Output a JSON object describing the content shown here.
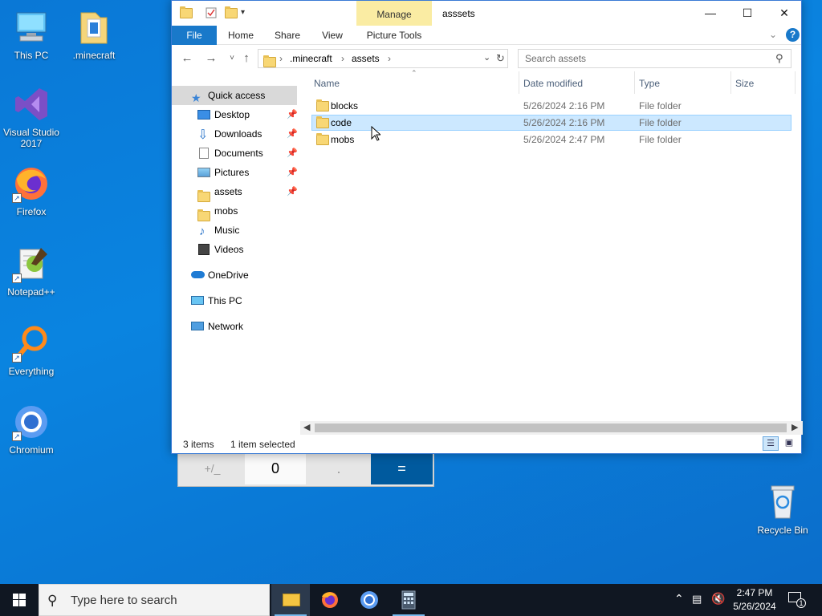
{
  "desktop": {
    "icons": [
      {
        "label": "This PC"
      },
      {
        "label": ".minecraft"
      },
      {
        "label": "Visual Studio 2017"
      },
      {
        "label": "Firefox"
      },
      {
        "label": "Notepad++"
      },
      {
        "label": "Everything"
      },
      {
        "label": "Chromium"
      },
      {
        "label": "Recycle Bin"
      }
    ]
  },
  "calculator": {
    "keys": [
      "+/_",
      "0",
      ".",
      "="
    ]
  },
  "window": {
    "title": "asssets",
    "manage_tab": "Manage",
    "ribbon_tabs": [
      "File",
      "Home",
      "Share",
      "View",
      "Picture Tools"
    ],
    "address": {
      "segments": [
        ".minecraft",
        "assets"
      ]
    },
    "search_placeholder": "Search assets",
    "nav": {
      "quick_access": "Quick access",
      "items": [
        {
          "label": "Desktop",
          "pinned": true
        },
        {
          "label": "Downloads",
          "pinned": true
        },
        {
          "label": "Documents",
          "pinned": true
        },
        {
          "label": "Pictures",
          "pinned": true
        },
        {
          "label": "assets",
          "pinned": true
        },
        {
          "label": "mobs",
          "pinned": false
        },
        {
          "label": "Music",
          "pinned": false
        },
        {
          "label": "Videos",
          "pinned": false
        }
      ],
      "onedrive": "OneDrive",
      "this_pc": "This PC",
      "network": "Network"
    },
    "columns": [
      "Name",
      "Date modified",
      "Type",
      "Size"
    ],
    "files": [
      {
        "name": "blocks",
        "date": "5/26/2024 2:16 PM",
        "type": "File folder",
        "selected": false
      },
      {
        "name": "code",
        "date": "5/26/2024 2:16 PM",
        "type": "File folder",
        "selected": true
      },
      {
        "name": "mobs",
        "date": "5/26/2024 2:47 PM",
        "type": "File folder",
        "selected": false
      }
    ],
    "status": {
      "count": "3 items",
      "selection": "1 item selected"
    }
  },
  "taskbar": {
    "search_placeholder": "Type here to search",
    "time": "2:47 PM",
    "date": "5/26/2024",
    "notification_count": "1"
  },
  "colors": {
    "accent": "#1979ca",
    "selection": "#cce8ff",
    "desktop": "#0a84e0",
    "taskbar": "#101722"
  }
}
